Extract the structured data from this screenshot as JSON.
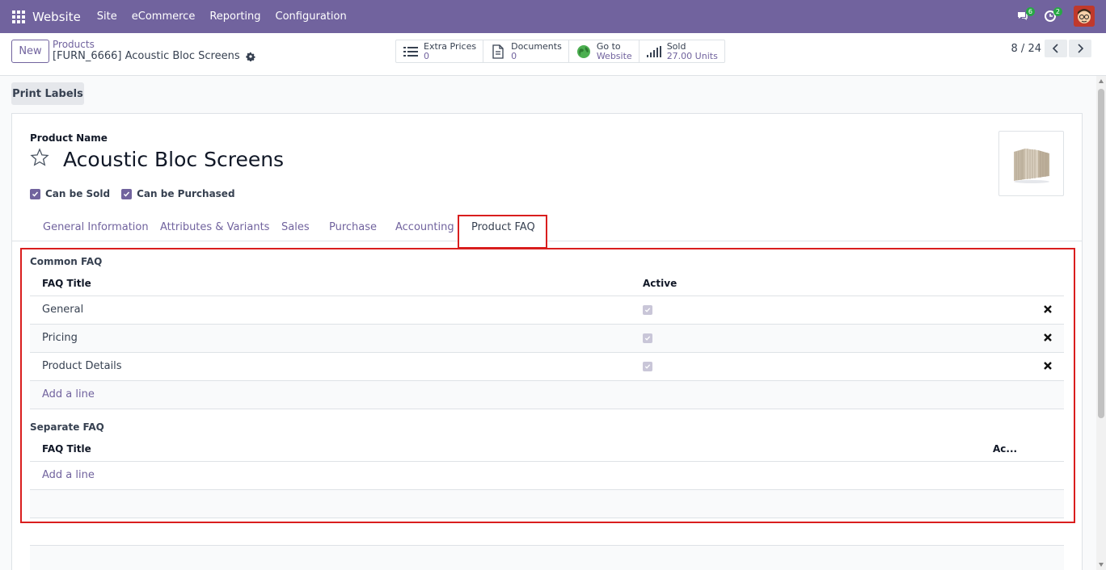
{
  "navbar": {
    "brand": "Website",
    "menu": [
      "Site",
      "eCommerce",
      "Reporting",
      "Configuration"
    ],
    "chat_badge": "6",
    "activity_badge": "2",
    "accent": "#71639e"
  },
  "control": {
    "new_label": "New",
    "breadcrumb_parent": "Products",
    "breadcrumb_current": "[FURN_6666] Acoustic Bloc Screens",
    "smart_buttons": [
      {
        "label": "Extra Prices",
        "value": "0",
        "icon": "list-icon"
      },
      {
        "label": "Documents",
        "value": "0",
        "icon": "document-icon"
      },
      {
        "label": "Go to",
        "value": "Website",
        "icon": "globe-icon"
      },
      {
        "label": "Sold",
        "value": "27.00 Units",
        "icon": "bar-chart-icon"
      }
    ],
    "pager": "8 / 24"
  },
  "actions": {
    "print_labels": "Print Labels"
  },
  "form": {
    "product_name_label": "Product Name",
    "product_name": "Acoustic Bloc Screens",
    "can_be_sold": "Can be Sold",
    "can_be_purchased": "Can be Purchased",
    "tabs": [
      "General Information",
      "Attributes & Variants",
      "Sales",
      "Purchase",
      "Accounting",
      "Product FAQ"
    ],
    "active_tab": "Product FAQ"
  },
  "faq": {
    "common_title": "Common FAQ",
    "col_title": "FAQ Title",
    "col_active": "Active",
    "rows": [
      {
        "title": "General",
        "active": true
      },
      {
        "title": "Pricing",
        "active": true
      },
      {
        "title": "Product Details",
        "active": true
      }
    ],
    "add_line": "Add a line",
    "separate_title": "Separate FAQ",
    "sep_col_title": "FAQ Title",
    "sep_col_active": "Ac...",
    "sep_add_line": "Add a line"
  }
}
